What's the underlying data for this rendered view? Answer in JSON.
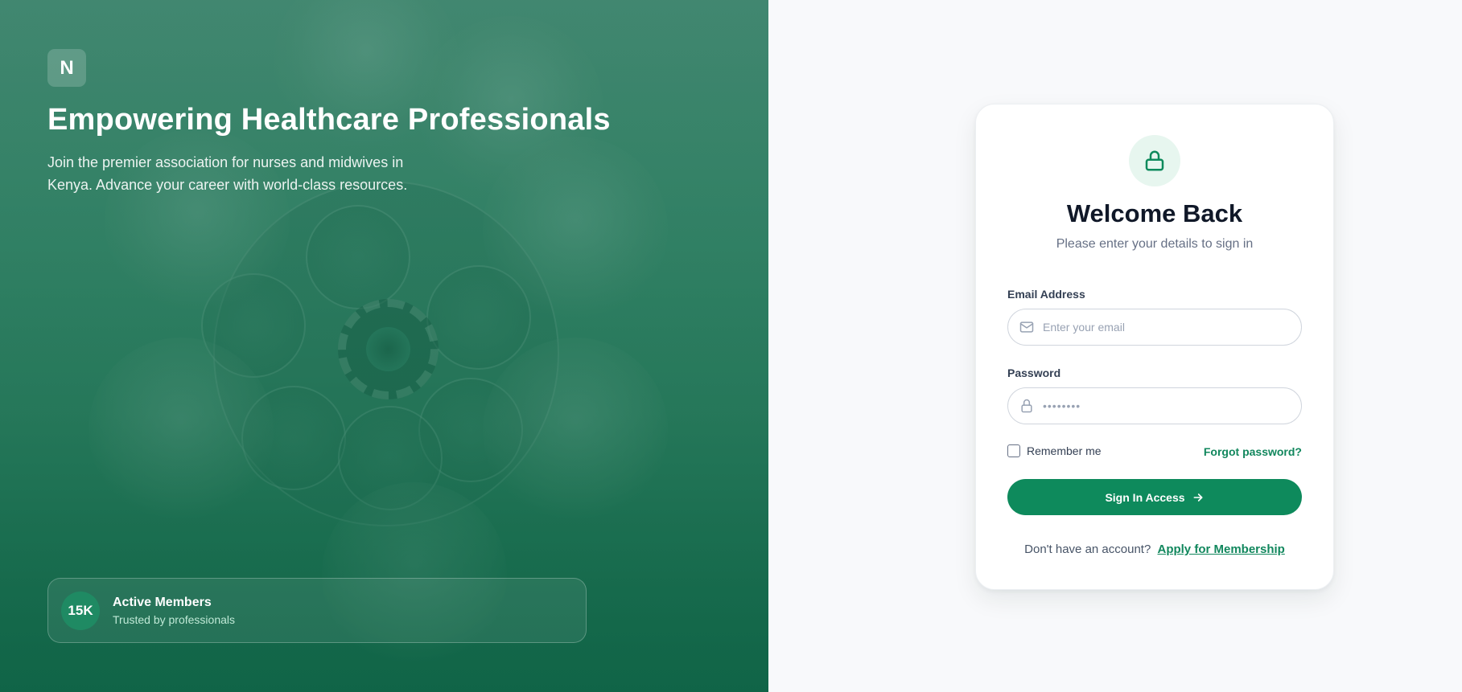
{
  "hero": {
    "logo_letter": "N",
    "title": "Empowering Healthcare Professionals",
    "subtitle": "Join the premier association for nurses and midwives in Kenya. Advance your career with world-class resources.",
    "stats": {
      "value": "15K",
      "title": "Active Members",
      "description": "Trusted by professionals"
    }
  },
  "login": {
    "title": "Welcome Back",
    "subtitle": "Please enter your details to sign in",
    "email_label": "Email Address",
    "email_placeholder": "Enter your email",
    "email_icon": "mail-icon",
    "password_label": "Password",
    "password_placeholder": "••••••••",
    "password_icon": "lock-icon",
    "remember_label": "Remember me",
    "remember_checked": false,
    "forgot_label": "Forgot password?",
    "signin_label": "Sign In Access",
    "signin_icon": "arrow-right-icon",
    "no_account_text": "Don't have an account?",
    "apply_label": "Apply for Membership"
  },
  "colors": {
    "brand": "#0e8a5c",
    "hero_dark": "#17664a",
    "text_dark": "#101828"
  }
}
